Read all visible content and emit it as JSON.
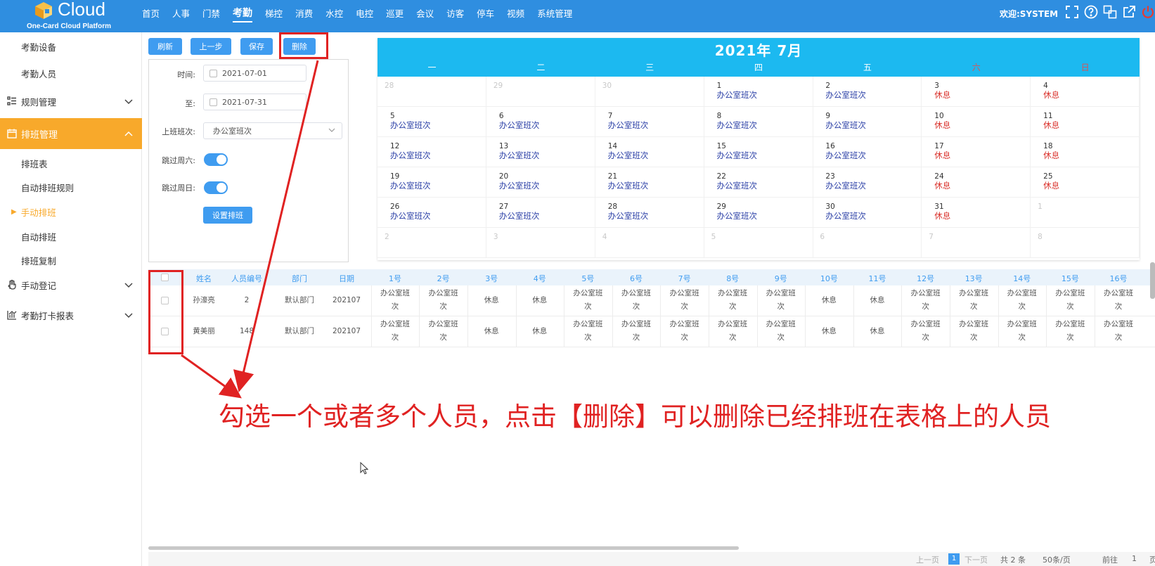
{
  "header": {
    "brand": "Cloud",
    "brand_sub": "One-Card Cloud Platform",
    "nav": [
      "首页",
      "人事",
      "门禁",
      "考勤",
      "梯控",
      "消费",
      "水控",
      "电控",
      "巡更",
      "会议",
      "访客",
      "停车",
      "视频",
      "系统管理"
    ],
    "active_nav": "考勤",
    "welcome": "欢迎:SYSTEM",
    "colors": {
      "topbar": "#2f8ee0",
      "accent": "#f8a92b",
      "primary": "#3f9cf0",
      "annotation": "#e02222"
    }
  },
  "sidebar": {
    "items": [
      {
        "label": "考勤设备"
      },
      {
        "label": "考勤人员"
      },
      {
        "label": "规则管理"
      },
      {
        "label": "排班管理"
      },
      {
        "label": "排班表"
      },
      {
        "label": "自动排班规则"
      },
      {
        "label": "手动排班"
      },
      {
        "label": "自动排班"
      },
      {
        "label": "排班复制"
      },
      {
        "label": "手动登记"
      },
      {
        "label": "考勤打卡报表"
      }
    ]
  },
  "toolbar": {
    "refresh": "刷新",
    "prev": "上一步",
    "save": "保存",
    "delete": "删除"
  },
  "form": {
    "time_label": "时间:",
    "time_from": "2021-07-01",
    "to_label": "至:",
    "time_to": "2021-07-31",
    "shift_label": "上班班次:",
    "shift_value": "办公室班次",
    "skip_sat_label": "跳过周六:",
    "skip_sat": true,
    "skip_sun_label": "跳过周日:",
    "skip_sun": true,
    "set_button": "设置排班"
  },
  "calendar": {
    "title": "2021年  7月",
    "weekdays": [
      "一",
      "二",
      "三",
      "四",
      "五",
      "六",
      "日"
    ],
    "work_label": "办公室班次",
    "rest_label": "休息",
    "leading_days": [
      "28",
      "29",
      "30"
    ],
    "month_days": [
      "1",
      "2",
      "3",
      "4",
      "5",
      "6",
      "7",
      "8",
      "9",
      "10",
      "11",
      "12",
      "13",
      "14",
      "15",
      "16",
      "17",
      "18",
      "19",
      "20",
      "21",
      "22",
      "23",
      "24",
      "25",
      "26",
      "27",
      "28",
      "29",
      "30",
      "31"
    ],
    "trailing_days": [
      "1",
      "2",
      "3",
      "4",
      "5",
      "6",
      "7",
      "8"
    ]
  },
  "table": {
    "headers": [
      "姓名",
      "人员编号",
      "部门",
      "日期",
      "1号",
      "2号",
      "3号",
      "4号",
      "5号",
      "6号",
      "7号",
      "8号",
      "9号",
      "10号",
      "11号",
      "12号",
      "13号",
      "14号",
      "15号",
      "16号"
    ],
    "rows": [
      {
        "name": "孙濠亮",
        "id": "2",
        "dept": "默认部门",
        "date": "202107"
      },
      {
        "name": "黄美丽",
        "id": "148",
        "dept": "默认部门",
        "date": "202107"
      }
    ],
    "cell_work_l1": "办公室班",
    "cell_work_l2": "次",
    "cell_rest": "休息"
  },
  "annotation": {
    "text": "勾选一个或者多个人员，点击【删除】可以删除已经排班在表格上的人员"
  },
  "pagination": {
    "prev": "上一页",
    "current": "1",
    "next": "下一页",
    "total": "共 2 条",
    "page_size": "50条/页",
    "goto": "前往",
    "goto_value": "1",
    "page_suffix": "页"
  }
}
